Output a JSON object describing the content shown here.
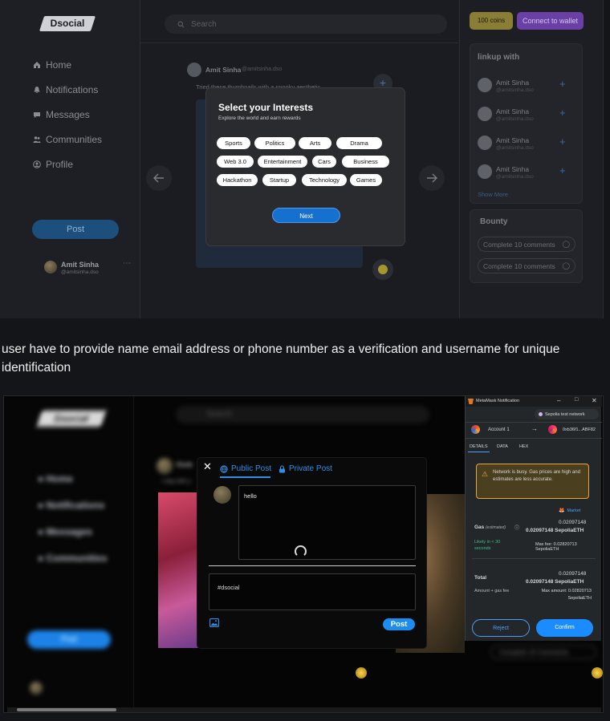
{
  "screenshot1": {
    "logo": "Dsocial",
    "nav": [
      {
        "label": "Home",
        "icon": "home-icon"
      },
      {
        "label": "Notifications",
        "icon": "bell-icon"
      },
      {
        "label": "Messages",
        "icon": "message-icon"
      },
      {
        "label": "Communities",
        "icon": "users-icon"
      },
      {
        "label": "Profile",
        "icon": "profile-icon"
      }
    ],
    "post_button": "Post",
    "user": {
      "name": "Amit Sinha",
      "handle": "@amitsinha.dso"
    },
    "search_placeholder": "Search",
    "feed_post": {
      "name": "Amit Sinha",
      "handle": "@amitsinha.dso",
      "text": "Tried these thumbnails with a spooky aesthetic"
    },
    "coins": "100 coins",
    "connect_wallet": "Connect to wallet",
    "linkup": {
      "title": "linkup with",
      "users": [
        {
          "name": "Amit Sinha",
          "handle": "@amitsinha.dso"
        },
        {
          "name": "Amit Sinha",
          "handle": "@amitsinha.dso"
        },
        {
          "name": "Amit Sinha",
          "handle": "@amitsinha.dso"
        },
        {
          "name": "Amit Sinha",
          "handle": "@amitsinha.dso"
        }
      ],
      "show_more": "Show More"
    },
    "bounty": {
      "title": "Bounty",
      "items": [
        "Complete 10 comments",
        "Complete 10 comments"
      ]
    },
    "modal": {
      "title": "Select your Interests",
      "subtitle": "Explore the world and earn rewards",
      "tags": [
        "Sports",
        "Politics",
        "Arts",
        "Drama",
        "Web 3.0",
        "Entertainment",
        "Cars",
        "Business",
        "Hackathon",
        "Startup",
        "Technology",
        "Games"
      ],
      "next": "Next"
    }
  },
  "caption": "user have to provide name email address or phone number as a verification and username for unique identification",
  "screenshot2": {
    "logo": "Dsocial",
    "search_placeholder": "Search",
    "nav": [
      "Home",
      "Notifications",
      "Messages",
      "Communities"
    ],
    "post_button": "Post",
    "feed_name": "Vivek",
    "feed_text": "I stay with y",
    "composer": {
      "tab_public": "Public Post",
      "tab_private": "Private Post",
      "post_text": "hello",
      "tags_text": "#dsocial",
      "post_button": "Post"
    },
    "bounty_item": "Complete 10 Comments",
    "metamask": {
      "window_title": "MetaMask Notification",
      "network": "Sepolia test network",
      "account": "Account 1",
      "to_address": "0xb36f1...ABF82",
      "tabs": [
        "DETAILS",
        "DATA",
        "HEX"
      ],
      "warning": "Network is busy. Gas prices are high and estimates are less accurate.",
      "market": "Market",
      "gas_label": "Gas",
      "gas_estimated": "(estimated)",
      "gas_value": "0.02097148",
      "gas_value_eth": "0.02097148 SepoliaETH",
      "likely": "Likely in < 30 seconds",
      "max_fee": "Max fee: 0.02820713 SepoliaETH",
      "total_label": "Total",
      "total_value": "0.02097148",
      "total_value_eth": "0.02097148 SepoliaETH",
      "amount_gas": "Amount + gas fee",
      "max_amount": "Max amount: 0.02820713 SepoliaETH",
      "reject": "Reject",
      "confirm": "Confirm"
    }
  }
}
